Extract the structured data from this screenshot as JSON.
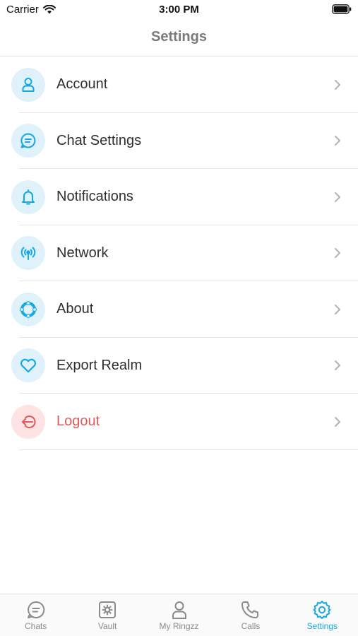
{
  "status_bar": {
    "carrier": "Carrier",
    "time": "3:00 PM"
  },
  "nav": {
    "title": "Settings"
  },
  "menu": {
    "items": [
      {
        "label": "Account",
        "icon": "user-icon"
      },
      {
        "label": "Chat Settings",
        "icon": "chat-bubble-icon"
      },
      {
        "label": "Notifications",
        "icon": "bell-icon"
      },
      {
        "label": "Network",
        "icon": "broadcast-icon"
      },
      {
        "label": "About",
        "icon": "lifebuoy-icon"
      },
      {
        "label": "Export Realm",
        "icon": "heart-icon"
      },
      {
        "label": "Logout",
        "icon": "logout-icon"
      }
    ]
  },
  "tabs": [
    {
      "label": "Chats",
      "icon": "chat-bubble-icon"
    },
    {
      "label": "Vault",
      "icon": "vault-icon"
    },
    {
      "label": "My Ringzz",
      "icon": "user-icon"
    },
    {
      "label": "Calls",
      "icon": "phone-icon"
    },
    {
      "label": "Settings",
      "icon": "gear-icon",
      "active": true
    }
  ],
  "colors": {
    "accent": "#17a8de",
    "icon_bg": "#dff2fb",
    "danger": "#e05a5a",
    "danger_bg": "#fde3e3",
    "title": "#7a7a7a"
  }
}
